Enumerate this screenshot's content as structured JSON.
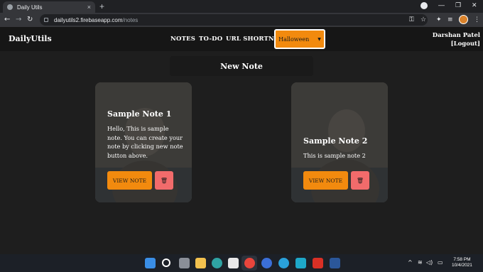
{
  "browser": {
    "tab_title": "Daily Utils",
    "tab_close": "×",
    "new_tab": "+",
    "url_host": "dailyutils2.firebaseapp.com",
    "url_path": "/notes",
    "back": "←",
    "forward": "→",
    "reload": "↻",
    "minimize": "—",
    "restore": "❐",
    "close": "✕",
    "key_icon": "⚿",
    "star_icon": "☆",
    "ext_icon": "✦",
    "media_icon": "≡",
    "menu_icon": "⋮"
  },
  "app": {
    "brand": "DailyUtils",
    "nav": [
      "NOTES",
      "TO-DO",
      "URL SHORTNER"
    ],
    "theme_label": "Halloween",
    "theme_caret": "▼",
    "user_name": "Darshan Patel",
    "logout": "[Logout]",
    "new_note": "New Note"
  },
  "notes": [
    {
      "title": "Sample Note 1",
      "body": "Hello, This is sample note. You can create your note by clicking new note button above.",
      "view_label": "VIEW NOTE",
      "delete_icon": "🗑"
    },
    {
      "title": "Sample Note 2",
      "body": "This is sample note 2",
      "view_label": "VIEW NOTE",
      "delete_icon": "🗑"
    }
  ],
  "taskbar": {
    "tray_chevron": "^",
    "wifi": "≋",
    "volume": "◁)",
    "battery": "▭",
    "time": "7:58 PM",
    "date": "10/4/2021"
  },
  "colors": {
    "accent": "#f28a0e",
    "danger": "#f26b6b",
    "background": "#1e1e1e"
  }
}
